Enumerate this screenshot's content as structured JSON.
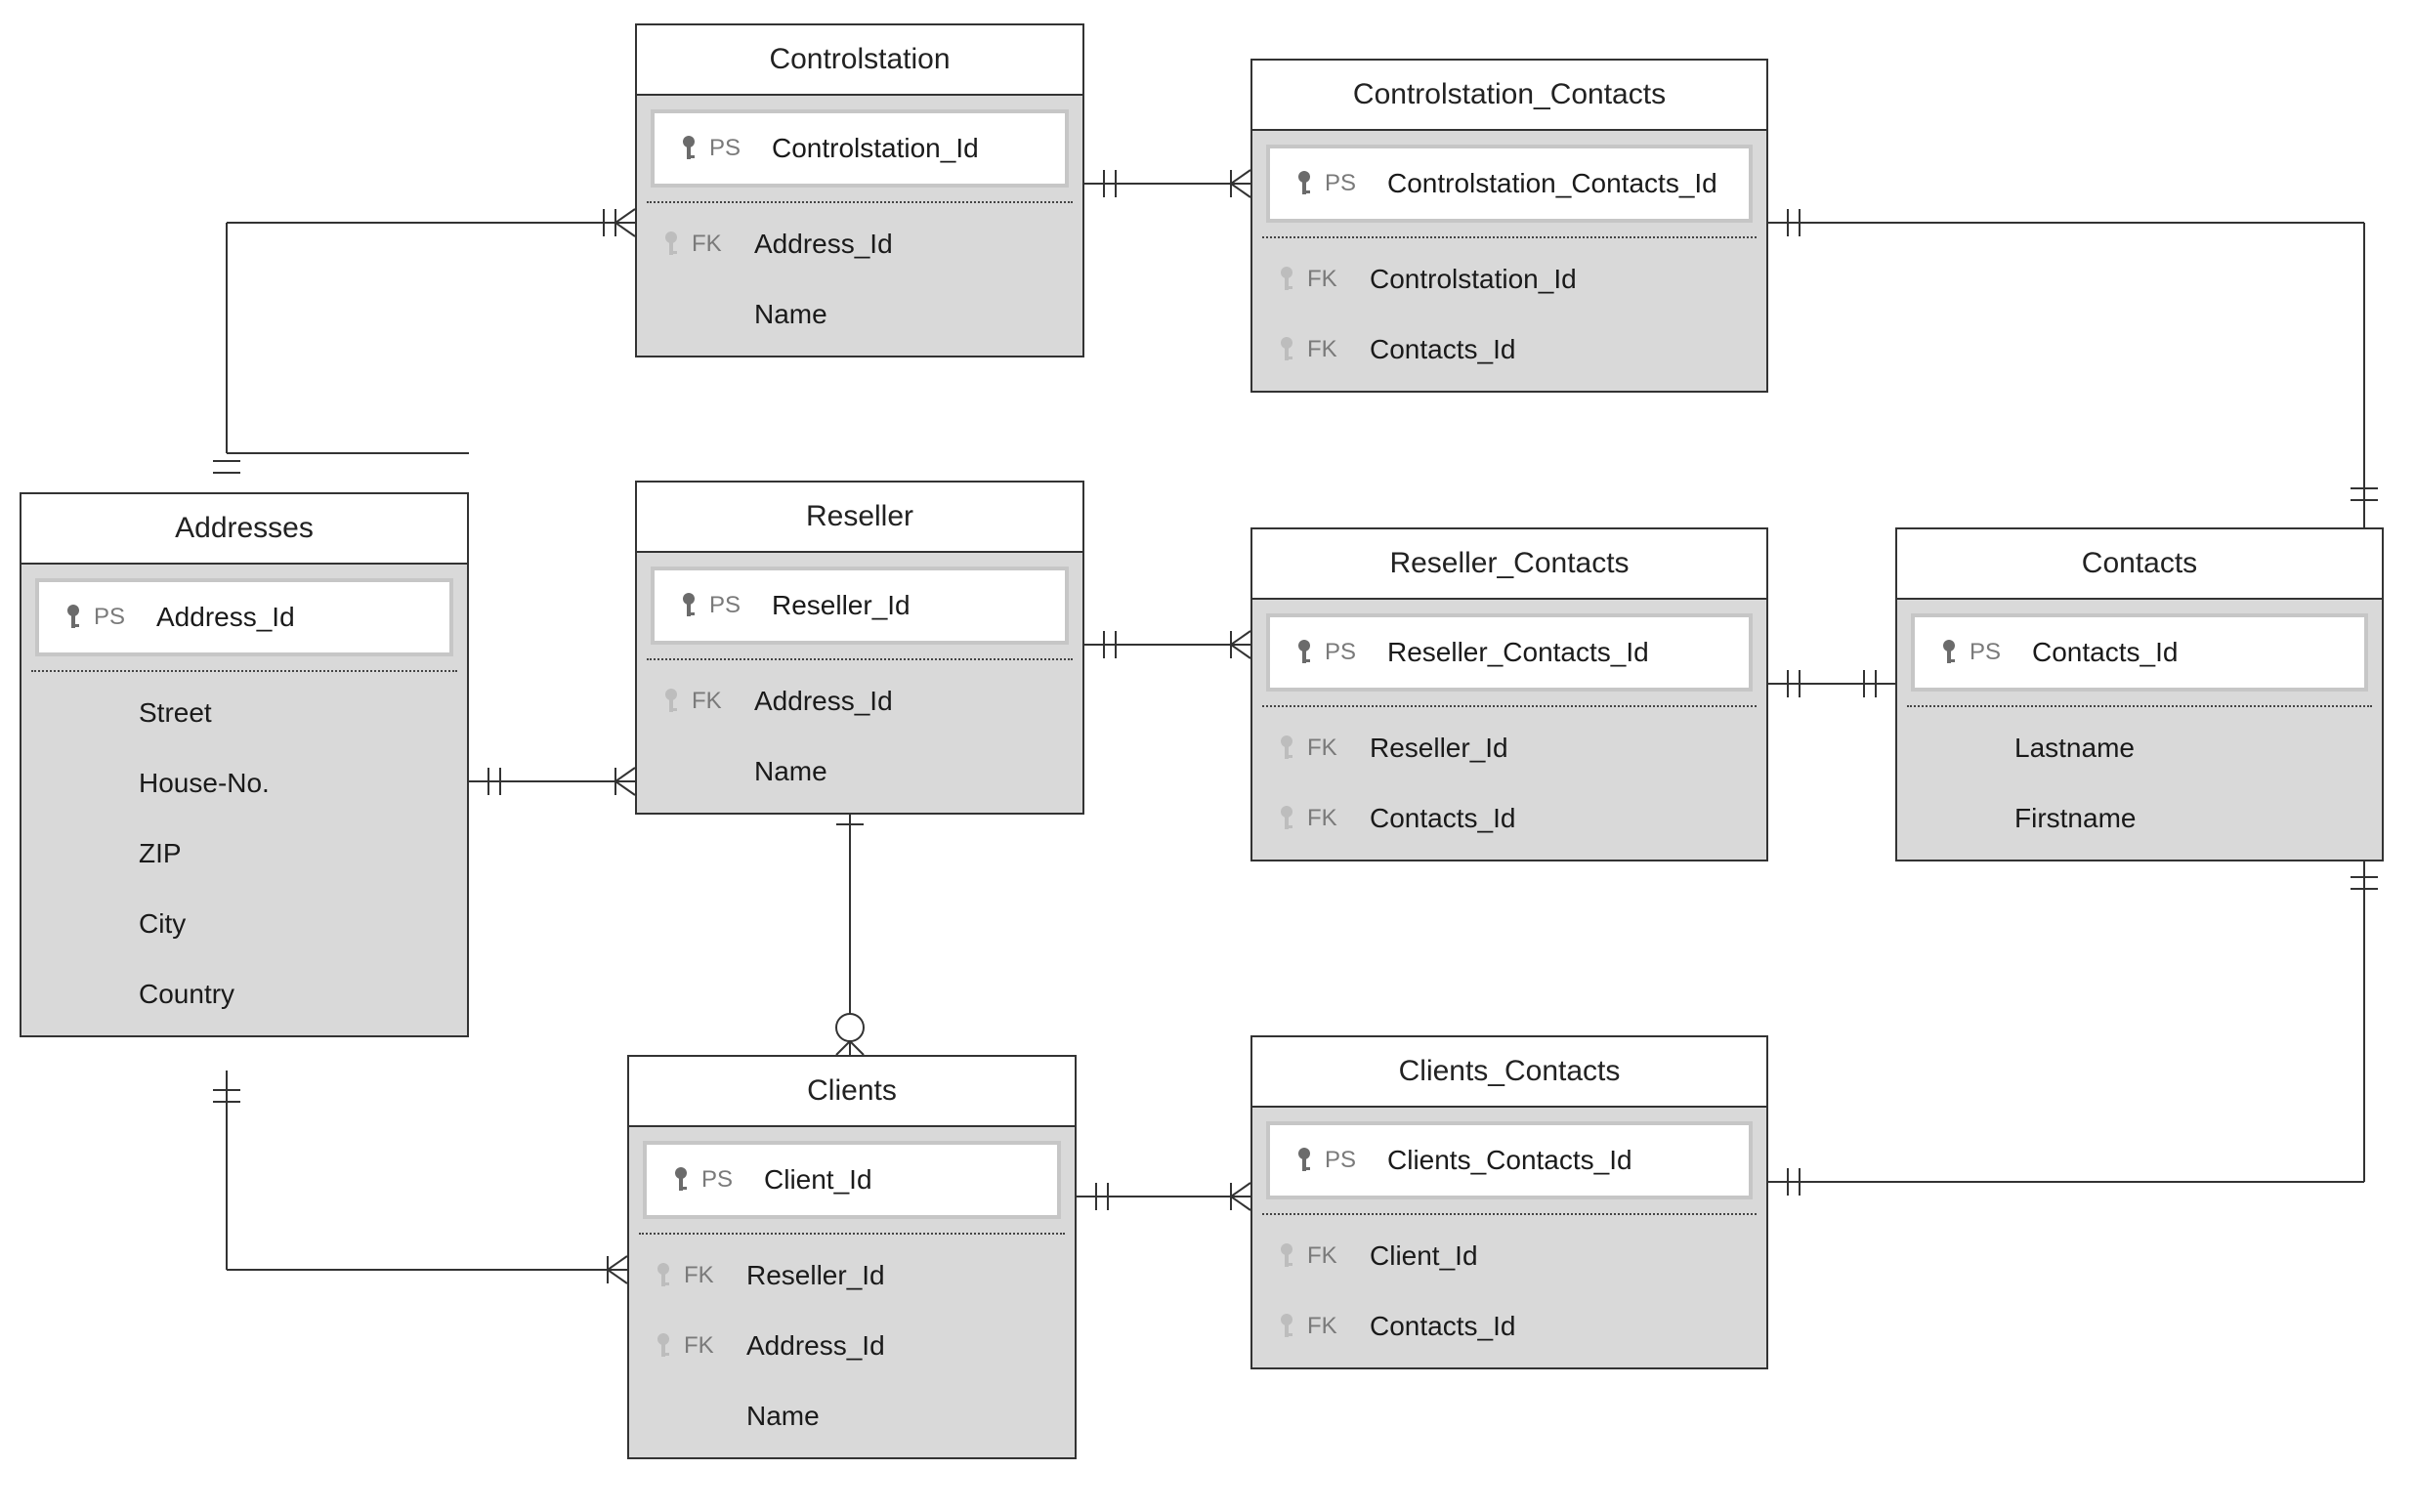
{
  "entities": {
    "addresses": {
      "title": "Addresses",
      "pk_label": "PS",
      "pk_field": "Address_Id",
      "rows": [
        {
          "keytype": "",
          "field": "Street"
        },
        {
          "keytype": "",
          "field": "House-No."
        },
        {
          "keytype": "",
          "field": "ZIP"
        },
        {
          "keytype": "",
          "field": "City"
        },
        {
          "keytype": "",
          "field": "Country"
        }
      ]
    },
    "controlstation": {
      "title": "Controlstation",
      "pk_label": "PS",
      "pk_field": "Controlstation_Id",
      "rows": [
        {
          "keytype": "FK",
          "field": "Address_Id",
          "icon": true
        },
        {
          "keytype": "",
          "field": "Name"
        }
      ]
    },
    "controlstation_contacts": {
      "title": "Controlstation_Contacts",
      "pk_label": "PS",
      "pk_field": "Controlstation_Contacts_Id",
      "rows": [
        {
          "keytype": "FK",
          "field": "Controlstation_Id",
          "icon": true
        },
        {
          "keytype": "FK",
          "field": "Contacts_Id",
          "icon": true
        }
      ]
    },
    "reseller": {
      "title": "Reseller",
      "pk_label": "PS",
      "pk_field": "Reseller_Id",
      "rows": [
        {
          "keytype": "FK",
          "field": "Address_Id",
          "icon": true
        },
        {
          "keytype": "",
          "field": "Name"
        }
      ]
    },
    "reseller_contacts": {
      "title": "Reseller_Contacts",
      "pk_label": "PS",
      "pk_field": "Reseller_Contacts_Id",
      "rows": [
        {
          "keytype": "FK",
          "field": "Reseller_Id",
          "icon": true
        },
        {
          "keytype": "FK",
          "field": "Contacts_Id",
          "icon": true
        }
      ]
    },
    "contacts": {
      "title": "Contacts",
      "pk_label": "PS",
      "pk_field": "Contacts_Id",
      "rows": [
        {
          "keytype": "",
          "field": "Lastname"
        },
        {
          "keytype": "",
          "field": "Firstname"
        }
      ]
    },
    "clients": {
      "title": "Clients",
      "pk_label": "PS",
      "pk_field": "Client_Id",
      "rows": [
        {
          "keytype": "FK",
          "field": "Reseller_Id",
          "icon": true
        },
        {
          "keytype": "FK",
          "field": "Address_Id",
          "icon": true
        },
        {
          "keytype": "",
          "field": "Name"
        }
      ]
    },
    "clients_contacts": {
      "title": "Clients_Contacts",
      "pk_label": "PS",
      "pk_field": "Clients_Contacts_Id",
      "rows": [
        {
          "keytype": "FK",
          "field": "Client_Id",
          "icon": true
        },
        {
          "keytype": "FK",
          "field": "Contacts_Id",
          "icon": true
        }
      ]
    }
  }
}
